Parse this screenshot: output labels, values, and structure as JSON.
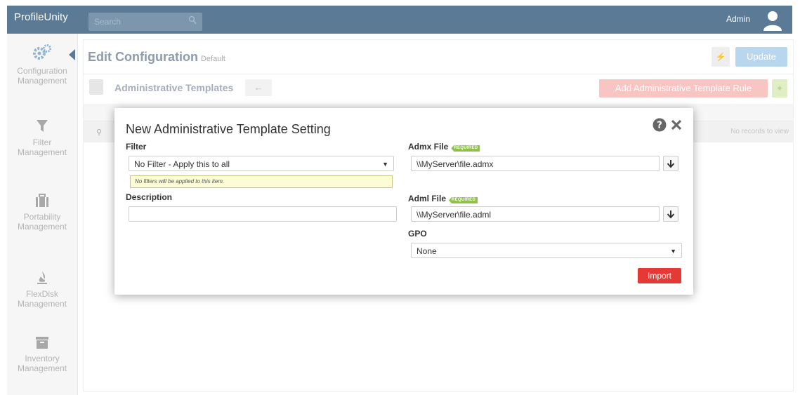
{
  "app": {
    "brand": "ProfileUnity",
    "search_placeholder": "Search",
    "user": "Admin"
  },
  "sidebar": {
    "items": [
      {
        "line1": "Configuration",
        "line2": "Management",
        "icon": "gears-icon"
      },
      {
        "line1": "Filter",
        "line2": "Management",
        "icon": "funnel-icon"
      },
      {
        "line1": "Portability",
        "line2": "Management",
        "icon": "briefcase-icon"
      },
      {
        "line1": "FlexDisk",
        "line2": "Management",
        "icon": "flame-icon"
      },
      {
        "line1": "Inventory",
        "line2": "Management",
        "icon": "archive-icon"
      }
    ]
  },
  "page": {
    "title": "Edit Configuration",
    "subtitle": "Default",
    "update_label": "Update",
    "section_title": "Administrative Templates",
    "add_rule_label": "Add Administrative Template Rule",
    "no_records": "No records to view"
  },
  "modal": {
    "title": "New Administrative Template Setting",
    "filter_label": "Filter",
    "filter_value": "No Filter - Apply this to all",
    "filter_hint": "No filters will be applied to this item.",
    "description_label": "Description",
    "description_value": "",
    "admx_label": "Admx File",
    "admx_value": "\\\\MyServer\\file.admx",
    "adml_label": "Adml File",
    "adml_value": "\\\\MyServer\\file.adml",
    "required_badge": "REQUIRED",
    "gpo_label": "GPO",
    "gpo_value": "None",
    "import_label": "Import"
  },
  "colors": {
    "topbar": "#5b7a96",
    "import": "#e53935",
    "required": "#8fc14b",
    "update": "#b8d6ee",
    "add_rule": "#f8c5c3"
  }
}
